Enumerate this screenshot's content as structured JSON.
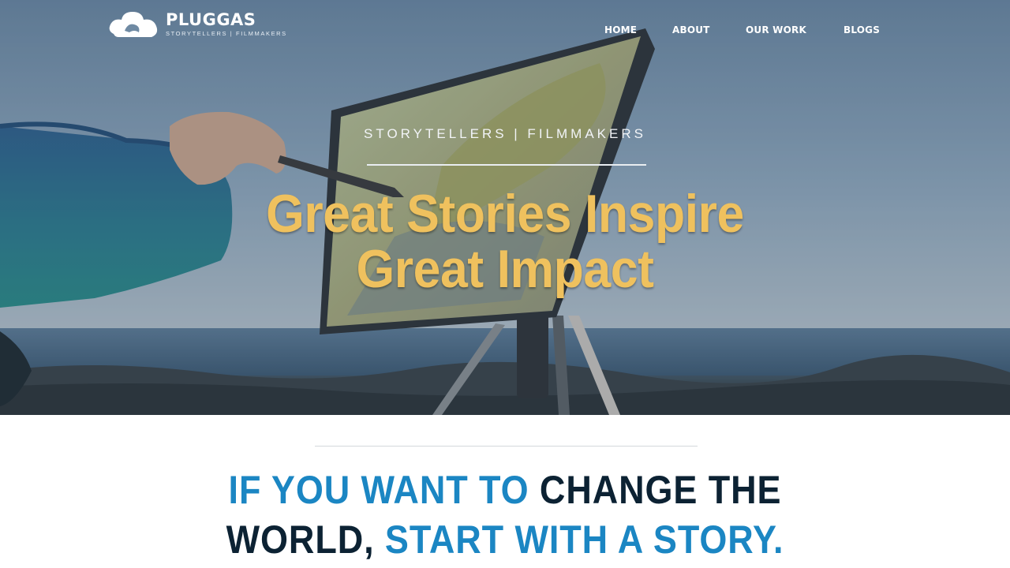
{
  "brand": {
    "name": "PLUGGAS",
    "tagline": "STORYTELLERS | FILMMAKERS",
    "logo_icon": "cloud-logo-icon"
  },
  "nav": {
    "items": [
      {
        "label": "HOME"
      },
      {
        "label": "ABOUT"
      },
      {
        "label": "OUR WORK"
      },
      {
        "label": "BLOGS"
      }
    ]
  },
  "hero": {
    "eyebrow": "STORYTELLERS | FILMMAKERS",
    "headline_line1": "Great Stories Inspire",
    "headline_line2": "Great Impact",
    "headline_color": "#efc15e",
    "background_image": "painter-at-easel-by-the-sea"
  },
  "tagline": {
    "part1": "IF YOU WANT TO",
    "part2": "CHANGE THE",
    "part3": "WORLD,",
    "part4": "START WITH A STORY.",
    "accent_color": "#1b86c3",
    "dark_color": "#0c2233"
  }
}
